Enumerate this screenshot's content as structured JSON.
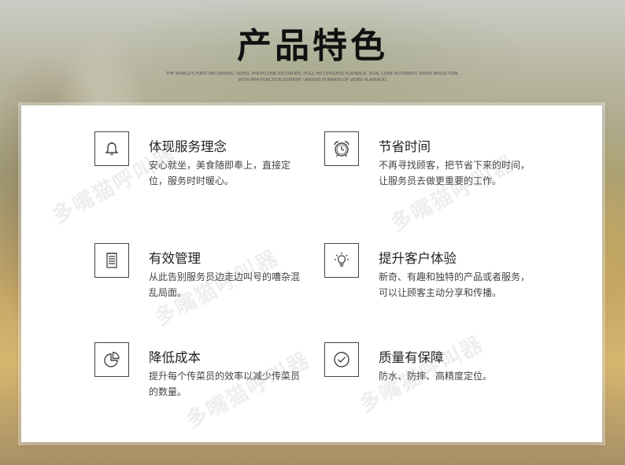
{
  "header": {
    "title": "产品特色",
    "subtitle_line1": "THE WORLD'S FIRST RECORDING, VIDEO, PHOTO ONE RECORDER, (FULL HD LOSSLESS PLAYBACK, DUAL CORE AUTOMATIC NOISE REDUCTION,",
    "subtitle_line2": "WITH MP4 FUNCTION,SUPPORT VARIOUS FORMATS OF VIDEO PLAYBACK)"
  },
  "features": [
    {
      "icon": "bell-icon",
      "title": "体现服务理念",
      "desc": "安心就坐，美食随即奉上，直接定位，服务时时暖心。"
    },
    {
      "icon": "alarm-clock-icon",
      "title": "节省时间",
      "desc": "不再寻找顾客，把节省下来的时间，让服务员去做更重要的工作。"
    },
    {
      "icon": "notepad-icon",
      "title": "有效管理",
      "desc": "从此告别服务员边走边叫号的嘈杂混乱局面。"
    },
    {
      "icon": "lightbulb-icon",
      "title": "提升客户体验",
      "desc": "新奇、有趣和独特的产品或者服务，可以让顾客主动分享和传播。"
    },
    {
      "icon": "pie-chart-icon",
      "title": "降低成本",
      "desc": "提升每个传菜员的效率以减少传菜员的数量。"
    },
    {
      "icon": "check-circle-icon",
      "title": "质量有保障",
      "desc": "防水、防摔、高精度定位。"
    }
  ],
  "watermark": "多嘴猫呼叫器",
  "colors": {
    "text": "#222222",
    "icon_stroke": "#444444",
    "panel": "#ffffff"
  }
}
